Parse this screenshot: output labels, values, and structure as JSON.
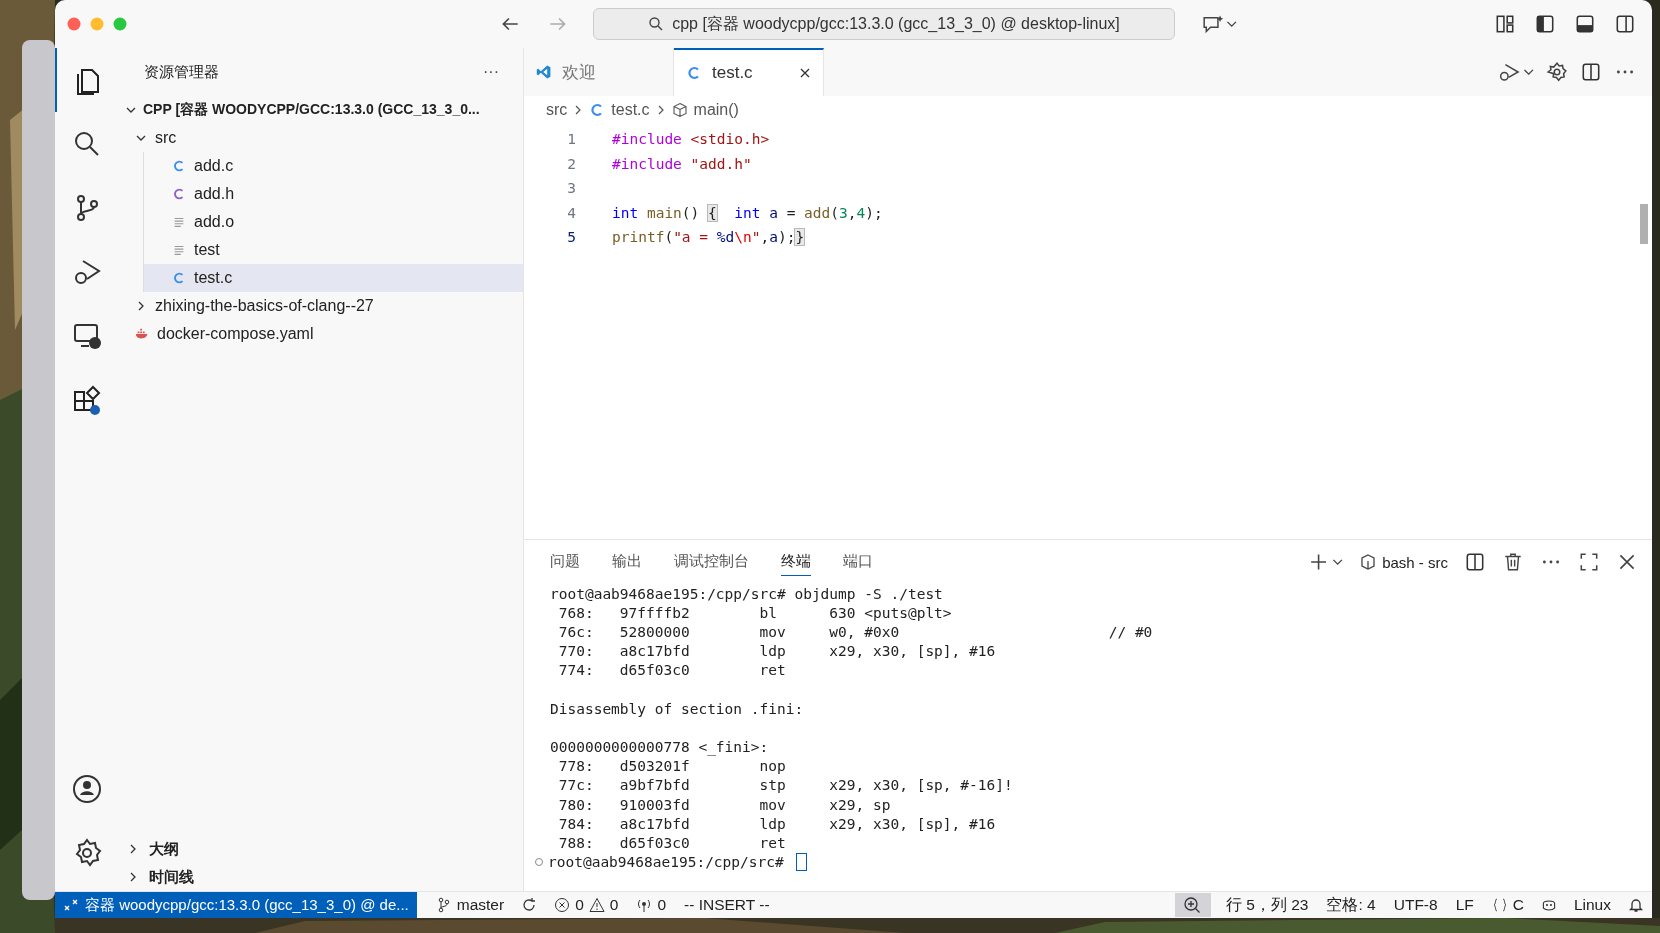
{
  "titlebar": {
    "search": "cpp [容器 woodycpp/gcc:13.3.0 (gcc_13_3_0) @ desktop-linux]"
  },
  "activity_bar": [
    {
      "kind": "files",
      "selected": true
    },
    {
      "kind": "search",
      "selected": false
    },
    {
      "kind": "source-control",
      "selected": false
    },
    {
      "kind": "run-debug",
      "selected": false
    },
    {
      "kind": "remote",
      "selected": false
    },
    {
      "kind": "extensions",
      "selected": false
    }
  ],
  "activity_bottom": [
    {
      "kind": "account"
    },
    {
      "kind": "settings"
    }
  ],
  "sidebar": {
    "title": "资源管理器",
    "more": "···",
    "root": {
      "label": "CPP [容器 WOODYCPP/GCC:13.3.0 (GCC_13_3_0...",
      "expanded": true,
      "children": [
        {
          "label": "src",
          "kind": "folder",
          "expanded": true,
          "selected": false,
          "children": [
            {
              "label": "add.c",
              "kind": "c",
              "selected": false
            },
            {
              "label": "add.h",
              "kind": "h",
              "selected": false
            },
            {
              "label": "add.o",
              "kind": "text",
              "selected": false
            },
            {
              "label": "test",
              "kind": "text",
              "selected": false
            },
            {
              "label": "test.c",
              "kind": "c",
              "selected": true
            }
          ]
        },
        {
          "label": "zhixing-the-basics-of-clang--27",
          "kind": "folder",
          "expanded": false,
          "selected": false
        },
        {
          "label": "docker-compose.yaml",
          "kind": "docker",
          "selected": false
        }
      ]
    },
    "sections": [
      {
        "label": "大纲",
        "expanded": false
      },
      {
        "label": "时间线",
        "expanded": false
      }
    ]
  },
  "tabs": [
    {
      "label": "欢迎",
      "kind": "welcome",
      "selected": false
    },
    {
      "label": "test.c",
      "kind": "c",
      "selected": true
    }
  ],
  "breadcrumb": [
    "src",
    "test.c",
    "main()"
  ],
  "code": [
    {
      "number": "1",
      "current": false,
      "tokens": [
        {
          "text": "#include ",
          "kind": "directive"
        },
        {
          "text": "<stdio.h>",
          "kind": "string"
        }
      ]
    },
    {
      "number": "2",
      "current": false,
      "tokens": [
        {
          "text": "#include ",
          "kind": "directive"
        },
        {
          "text": "\"add.h\"",
          "kind": "string"
        }
      ]
    },
    {
      "number": "3",
      "current": false
    },
    {
      "number": "4",
      "current": false,
      "tokens": [
        {
          "text": "int ",
          "kind": "type"
        },
        {
          "text": "main",
          "kind": "func"
        },
        {
          "text": "() ",
          "kind": "plain"
        },
        {
          "text": "{",
          "kind": "bracket"
        },
        {
          "text": "  int ",
          "kind": "type"
        },
        {
          "text": "a",
          "kind": "var"
        },
        {
          "text": " = ",
          "kind": "plain"
        },
        {
          "text": "add",
          "kind": "func"
        },
        {
          "text": "(",
          "kind": "plain"
        },
        {
          "text": "3",
          "kind": "num"
        },
        {
          "text": ",",
          "kind": "plain"
        },
        {
          "text": "4",
          "kind": "num"
        },
        {
          "text": ");",
          "kind": "plain"
        }
      ]
    },
    {
      "number": "5",
      "current": true,
      "tokens": [
        {
          "text": "printf",
          "kind": "func"
        },
        {
          "text": "(",
          "kind": "plain"
        },
        {
          "text": "\"a = ",
          "kind": "string"
        },
        {
          "text": "%d",
          "kind": "var"
        },
        {
          "text": "\\n",
          "kind": "escape"
        },
        {
          "text": "\"",
          "kind": "string"
        },
        {
          "text": ",",
          "kind": "plain"
        },
        {
          "text": "a",
          "kind": "var"
        },
        {
          "text": ");",
          "kind": "plain"
        },
        {
          "text": "}",
          "kind": "bracket"
        }
      ]
    }
  ],
  "panel": {
    "tabs": [
      {
        "label": "问题",
        "selected": false
      },
      {
        "label": "输出",
        "selected": false
      },
      {
        "label": "调试控制台",
        "selected": false
      },
      {
        "label": "终端",
        "selected": true
      },
      {
        "label": "端口",
        "selected": false
      }
    ],
    "terminal_name": "bash - src",
    "blocks": [
      [
        "root@aab9468ae195:/cpp/src# objdump -S ./test",
        " 768:   97ffffb2        bl      630 <puts@plt>",
        " 76c:   52800000        mov     w0, #0x0                        // #0",
        " 770:   a8c17bfd        ldp     x29, x30, [sp], #16",
        " 774:   d65f03c0        ret"
      ],
      [
        "Disassembly of section .fini:"
      ],
      [
        "0000000000000778 <_fini>:",
        " 778:   d503201f        nop",
        " 77c:   a9bf7bfd        stp     x29, x30, [sp, #-16]!",
        " 780:   910003fd        mov     x29, sp",
        " 784:   a8c17bfd        ldp     x29, x30, [sp], #16",
        " 788:   d65f03c0        ret"
      ]
    ],
    "prompt": "root@aab9468ae195:/cpp/src#"
  },
  "status_bar": {
    "remote": "容器 woodycpp/gcc:13.3.0 (gcc_13_3_0) @ de...",
    "branch": "master",
    "errors": "0",
    "warnings": "0",
    "ports": "0",
    "mode": "-- INSERT --",
    "position": "行 5，列 23",
    "indent": "空格: 4",
    "encoding": "UTF-8",
    "eol": "LF",
    "language": "C",
    "os": "Linux"
  }
}
